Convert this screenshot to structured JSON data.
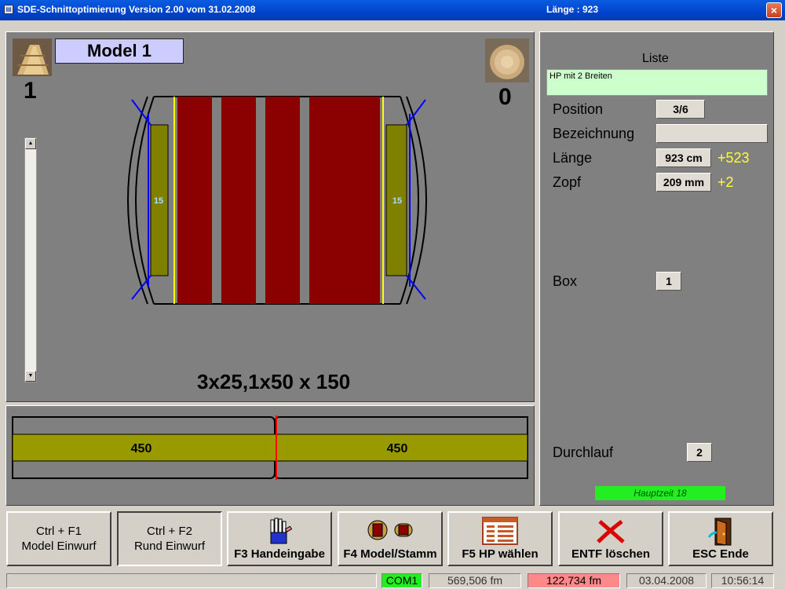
{
  "window": {
    "title": "SDE-Schnittoptimierung  Version 2.00 vom 31.02.2008",
    "length_title": "Länge : 923",
    "close_glyph": "×"
  },
  "main": {
    "model_label": "Model 1",
    "left_count": "1",
    "right_count": "0",
    "dimensions": "3x25,1x50 x 150",
    "side_boards": [
      "15",
      "15"
    ],
    "colors": {
      "board": "#8b0000",
      "side_board": "#808000",
      "cut_line": "#ffff00",
      "trim_line": "#0000ff"
    }
  },
  "length_bar": {
    "segments": [
      "450",
      "450"
    ],
    "colors": {
      "bar": "#999900",
      "marker": "#ff0000"
    }
  },
  "right": {
    "liste_title": "Liste",
    "liste_value": "HP mit 2 Breiten",
    "position_label": "Position",
    "position_value": "3/6",
    "bezeichnung_label": "Bezeichnung",
    "bezeichnung_value": "",
    "laenge_label": "Länge",
    "laenge_value": "923 cm",
    "laenge_delta": "+523",
    "zopf_label": "Zopf",
    "zopf_value": "209 mm",
    "zopf_delta": "+2",
    "box_label": "Box",
    "box_value": "1",
    "durchlauf_label": "Durchlauf",
    "durchlauf_value": "2",
    "hauptzeit": "Hauptzeit 18"
  },
  "buttons": [
    {
      "line1": "Ctrl + F1",
      "line2": "Model Einwurf"
    },
    {
      "line1": "Ctrl + F2",
      "line2": "Rund Einwurf"
    },
    {
      "label": "F3 Handeingabe",
      "icon": "hand-icon"
    },
    {
      "label": "F4 Model/Stamm",
      "icon": "log-icon"
    },
    {
      "label": "F5 HP wählen",
      "icon": "list-icon"
    },
    {
      "label": "ENTF löschen",
      "icon": "delete-x-icon"
    },
    {
      "label": "ESC Ende",
      "icon": "door-exit-icon"
    }
  ],
  "statusbar": {
    "port": "COM1",
    "volume1": "569,506 fm",
    "volume2": "122,734 fm",
    "date": "03.04.2008",
    "time": "10:56:14",
    "colors": {
      "port": "#22ee22",
      "volume2": "#ff8888"
    }
  }
}
